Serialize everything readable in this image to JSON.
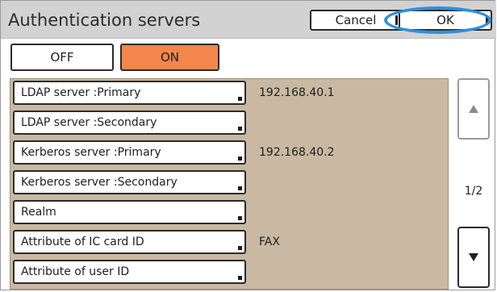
{
  "header": {
    "title": "Authentication servers",
    "cancel_label": "Cancel",
    "ok_label": "OK"
  },
  "toggle": {
    "off_label": "OFF",
    "on_label": "ON",
    "selected": "ON"
  },
  "servers": [
    {
      "label": "LDAP server :Primary",
      "value": "192.168.40.1"
    },
    {
      "label": "LDAP server :Secondary",
      "value": ""
    },
    {
      "label": "Kerberos server :Primary",
      "value": "192.168.40.2"
    },
    {
      "label": "Kerberos server :Secondary",
      "value": ""
    },
    {
      "label": "Realm",
      "value": ""
    },
    {
      "label": "Attribute of IC card ID",
      "value": "FAX"
    },
    {
      "label": "Attribute of user ID",
      "value": ""
    }
  ],
  "pagination": {
    "page": "1/2",
    "up_icon": "triangle-up-icon",
    "down_icon": "triangle-down-icon"
  },
  "colors": {
    "accent_on": "#f3864a",
    "panel_bg": "#c9b9a2",
    "highlight_ring": "#2e90dd"
  }
}
